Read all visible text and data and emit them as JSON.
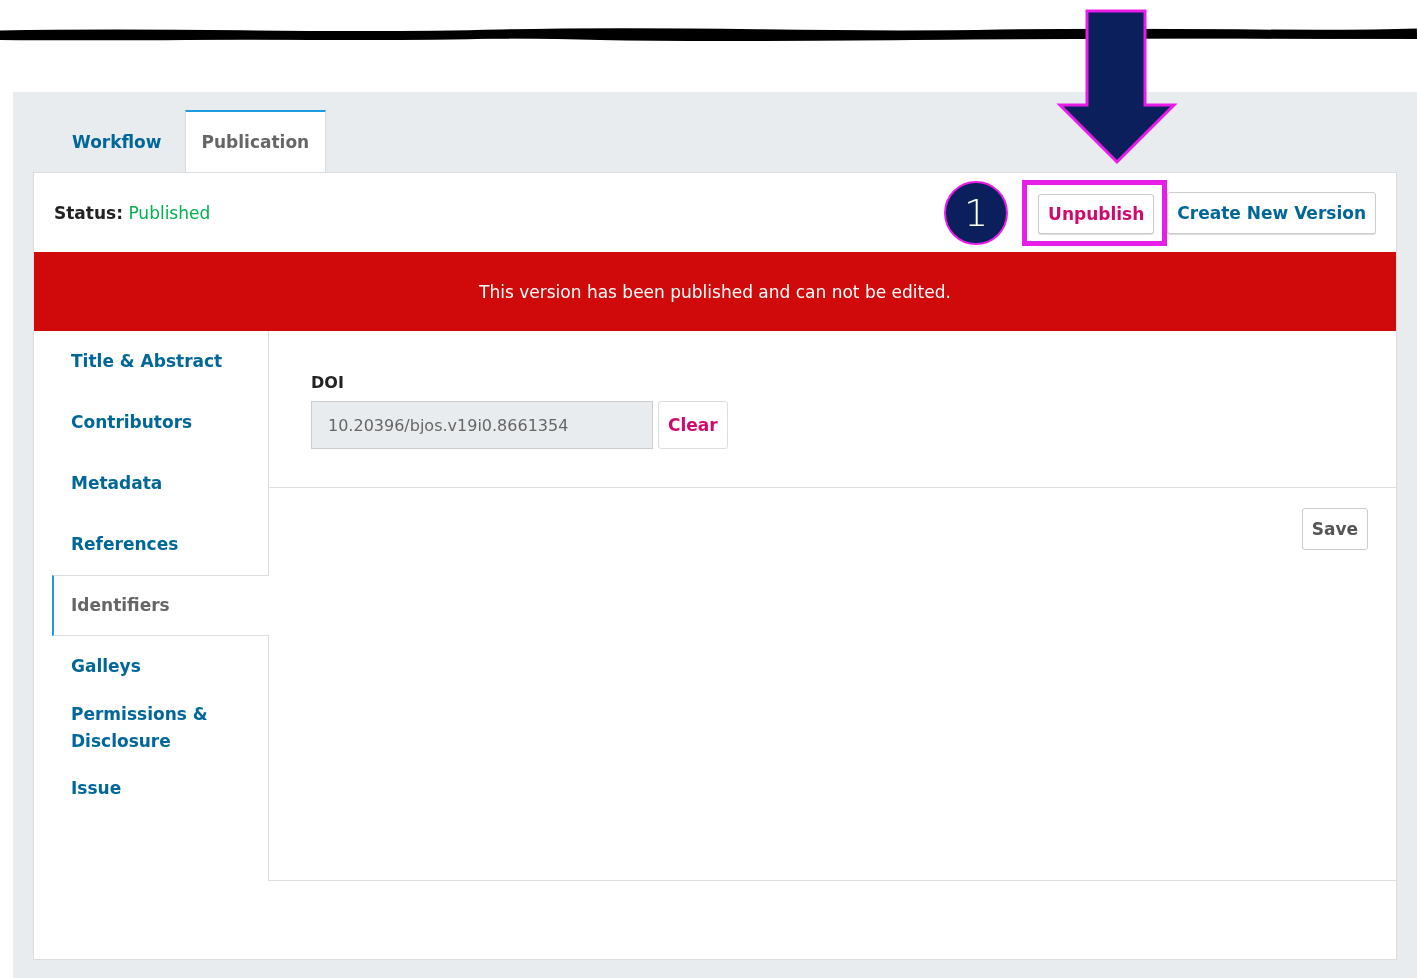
{
  "tabs": [
    {
      "label": "Workflow",
      "selected": false
    },
    {
      "label": "Publication",
      "selected": true
    }
  ],
  "status": {
    "label": "Status:",
    "value": "Published"
  },
  "annotation": {
    "number": "1"
  },
  "header_buttons": [
    {
      "label": "Unpublish",
      "kind": "danger",
      "highlighted": true
    },
    {
      "label": "Create New Version",
      "kind": "primary",
      "highlighted": false
    }
  ],
  "banner": "This version has been published and can not be edited.",
  "sidebar": {
    "items": [
      {
        "label": "Title & Abstract",
        "selected": false
      },
      {
        "label": "Contributors",
        "selected": false
      },
      {
        "label": "Metadata",
        "selected": false
      },
      {
        "label": "References",
        "selected": false
      },
      {
        "label": "Identifiers",
        "selected": true
      },
      {
        "label": "Galleys",
        "selected": false
      },
      {
        "label": "Permissions & Disclosure",
        "selected": false
      },
      {
        "label": "Issue",
        "selected": false
      }
    ]
  },
  "doi": {
    "label": "DOI",
    "value": "10.20396/bjos.v19i0.8661354",
    "clear_button": "Clear"
  },
  "save_button": "Save"
}
